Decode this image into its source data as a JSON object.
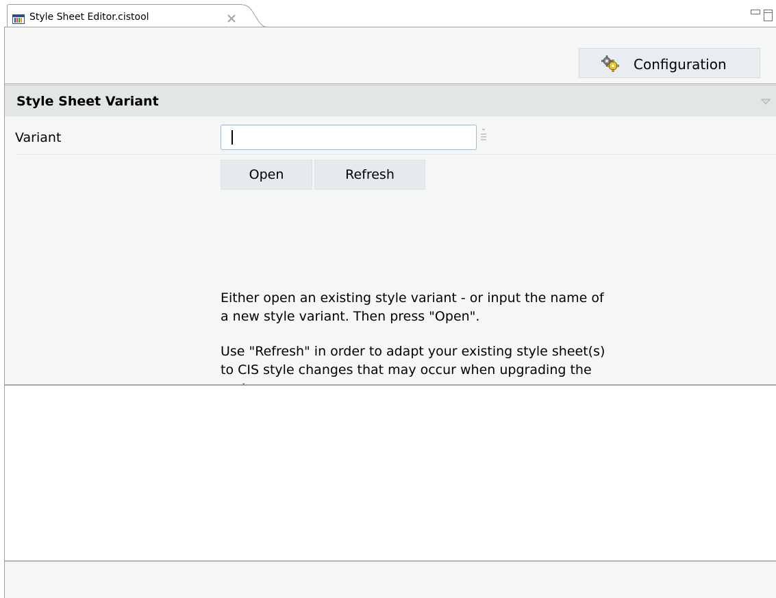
{
  "tab": {
    "title": "Style Sheet Editor.cistool",
    "icon": "editor-icon",
    "close_icon": "close-icon"
  },
  "view_controls": {
    "minimize_icon": "minimize-icon",
    "maximize_icon": "maximize-icon"
  },
  "toolbar": {
    "configuration_label": "Configuration",
    "configuration_icon": "gears-icon"
  },
  "section": {
    "title": "Style Sheet Variant",
    "collapse_icon": "chevron-down-icon"
  },
  "form": {
    "variant_label": "Variant",
    "variant_value": "",
    "value_help_icon": "value-help-icon"
  },
  "buttons": {
    "open_label": "Open",
    "refresh_label": "Refresh"
  },
  "help": {
    "line1": "Either open an existing style variant - or input the name of",
    "line2": "a new style variant. Then press \"Open\".",
    "line3": "Use \"Refresh\" in order to adapt your existing style sheet(s)",
    "line4": "to CIS style changes that may occur when upgrading the",
    "line5": "system."
  },
  "colors": {
    "section_header_bg": "#e2e6e6",
    "button_bg": "#e6eaee",
    "input_border": "#9fb6cc"
  }
}
